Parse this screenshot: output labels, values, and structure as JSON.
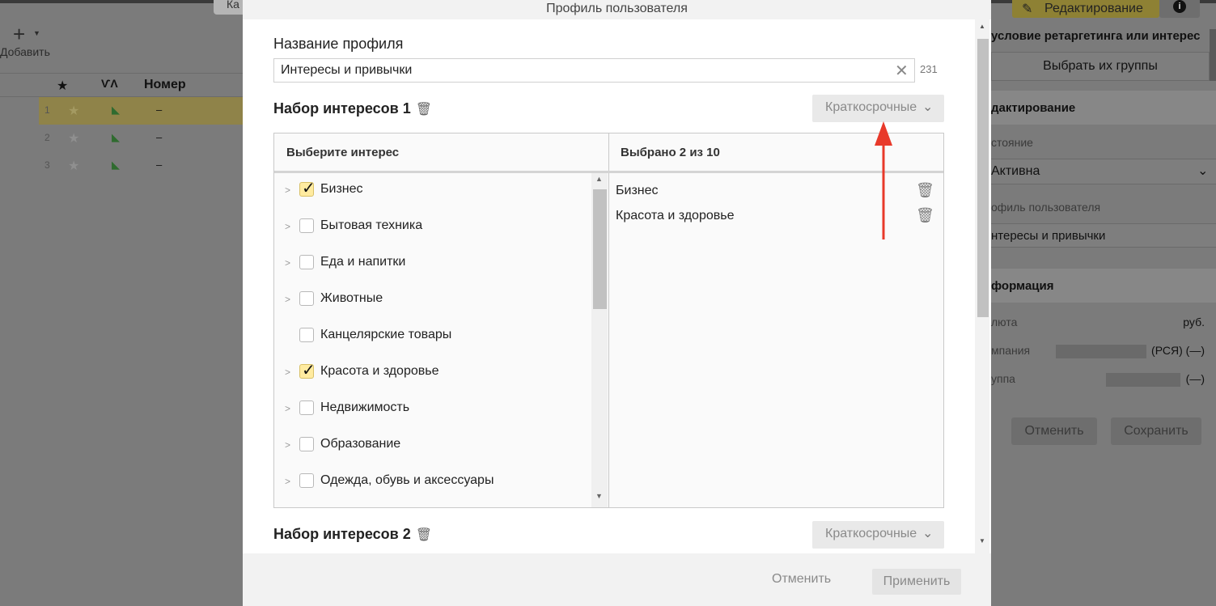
{
  "background": {
    "left": {
      "tab_label": "Ка",
      "add_label": "Добавить",
      "columns": {
        "star": "★",
        "strategy": "ѴΛ",
        "number": "Номер"
      },
      "rows": [
        {
          "idx": "1",
          "value": "–"
        },
        {
          "idx": "2",
          "value": "–"
        },
        {
          "idx": "3",
          "value": "–"
        }
      ]
    },
    "right": {
      "edit_button": "Редактирование",
      "info_icon": "i",
      "title": "условие ретаргетинга или интерес",
      "groups_button": "Выбрать их группы",
      "section_edit": "дактирование",
      "state_label": "стояние",
      "state_value": "Активна",
      "profile_label": "офиль пользователя",
      "profile_value": "нтересы и привычки",
      "section_info": "формация",
      "currency_label": "люта",
      "currency_value": "руб.",
      "campaign_label": "мпания",
      "campaign_value": "(РСЯ) (—)",
      "group_label": "уппа",
      "group_value": "(—)",
      "cancel_button": "Отменить",
      "save_button": "Сохранить"
    }
  },
  "modal": {
    "title": "Профиль пользователя",
    "profile_name_label": "Название профиля",
    "profile_name_value": "Интересы и привычки",
    "char_counter": "231",
    "interest_sets": [
      {
        "title": "Набор интересов 1",
        "term": "Краткосрочные"
      },
      {
        "title": "Набор интересов 2",
        "term": "Краткосрочные"
      }
    ],
    "choose_header": "Выберите интерес",
    "selected_header": "Выбрано 2 из 10",
    "interests": [
      {
        "label": "Бизнес",
        "checked": true,
        "has_children": true
      },
      {
        "label": "Бытовая техника",
        "checked": false,
        "has_children": true
      },
      {
        "label": "Еда и напитки",
        "checked": false,
        "has_children": true
      },
      {
        "label": "Животные",
        "checked": false,
        "has_children": true
      },
      {
        "label": "Канцелярские товары",
        "checked": false,
        "has_children": false
      },
      {
        "label": "Красота и здоровье",
        "checked": true,
        "has_children": true
      },
      {
        "label": "Недвижимость",
        "checked": false,
        "has_children": true
      },
      {
        "label": "Образование",
        "checked": false,
        "has_children": true
      },
      {
        "label": "Одежда, обувь и аксессуары",
        "checked": false,
        "has_children": true
      }
    ],
    "selected": [
      {
        "label": "Бизнес"
      },
      {
        "label": "Красота и здоровье"
      }
    ],
    "cancel_button": "Отменить",
    "apply_button": "Применить"
  },
  "colors": {
    "checked_fill": "#ffeba0",
    "annotation_arrow": "#e8392a",
    "edit_button": "#8e8134"
  }
}
